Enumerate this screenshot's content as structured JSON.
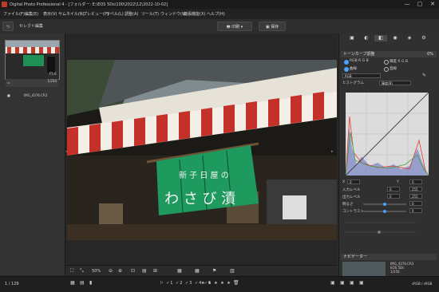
{
  "window": {
    "title": "Digital Photo Professional 4 - [フォルダー: E:\\EOS 5Ds\\100\\2022\\12\\2022-10-02]",
    "controls": {
      "minimize": "—",
      "maximize": "▢",
      "close": "✕"
    }
  },
  "menu": [
    "ファイル(F)",
    "編集(E)",
    "表示(V)",
    "サムネイル(N)",
    "プレビュー(P)",
    "ラベル(L)",
    "調整(A)",
    "ツール(T)",
    "ウィンドウ(W)",
    "拡張機能(X)",
    "ヘルプ(H)"
  ],
  "toolbar": {
    "back_label": "セレクト編集",
    "print_label": "印刷",
    "save_label": "保存"
  },
  "thumbnail": {
    "filename": "IMG_4376.CR3",
    "info_line1": "1/250",
    "info_line2": "F5.6"
  },
  "photo": {
    "noren_text_top": "新 子 日 屋 の",
    "noren_text_main": "わ さ び 漬"
  },
  "bottombar": {
    "zoom": "50%"
  },
  "status": {
    "count": "1 / 129",
    "right": "sRGB / sRGB"
  },
  "rightpanel": {
    "tone_header": "トーンカーブ調整",
    "tone_value": "0%",
    "radio_rgb": "RGB R G B",
    "radio_luminance": "輝度 R G B",
    "radio_linear": "曲線",
    "radio_spline": "直線",
    "channel_select": "RGB",
    "histogram_label": "ヒストグラム",
    "histogram_select": "輝度(B)",
    "x_label": "X",
    "y_label": "Y",
    "in_black_label": "入力レベル",
    "out_black_label": "出力レベル",
    "brightness_label": "明るさ",
    "contrast_label": "コントラスト",
    "x_value": "0",
    "y_value": "0",
    "in_value1": "0",
    "in_value2": "255",
    "out_value1": "0",
    "out_value2": "255",
    "brightness_value": "0",
    "contrast_value": "0",
    "navigator_header": "ナビゲーター",
    "nav_info": "IMG_4376.CR3",
    "nav_line2": "EOS 5Ds",
    "nav_line3": "1/250",
    "nav_line4": "F5.6",
    "nav_line5": "ISO 100"
  }
}
